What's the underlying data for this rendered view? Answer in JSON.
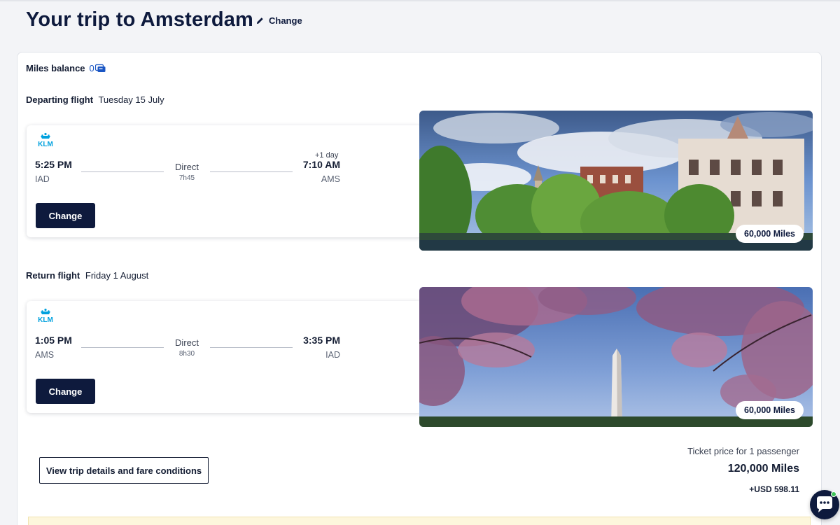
{
  "header": {
    "title": "Your trip to Amsterdam",
    "change_label": "Change"
  },
  "miles_balance": {
    "label": "Miles balance",
    "value": "0"
  },
  "departing": {
    "heading": "Departing flight",
    "date": "Tuesday 15 July",
    "airline": "KLM",
    "depart_time": "5:25 PM",
    "depart_airport": "IAD",
    "stops": "Direct",
    "duration": "7h45",
    "day_offset": "+1 day",
    "arrive_time": "7:10 AM",
    "arrive_airport": "AMS",
    "change_label": "Change",
    "image_icon": "amsterdam-canal-photo",
    "miles": "60,000 Miles"
  },
  "return": {
    "heading": "Return flight",
    "date": "Friday 1 August",
    "airline": "KLM",
    "depart_time": "1:05 PM",
    "depart_airport": "AMS",
    "stops": "Direct",
    "duration": "8h30",
    "arrive_time": "3:35 PM",
    "arrive_airport": "IAD",
    "change_label": "Change",
    "image_icon": "washington-cherry-blossom-photo",
    "miles": "60,000 Miles"
  },
  "footer": {
    "view_details_label": "View trip details and fare conditions",
    "price_label": "Ticket price for 1 passenger",
    "price_miles": "120,000 Miles",
    "price_usd": "+USD 598.11"
  },
  "colors": {
    "navy": "#0e1a3d",
    "klm_blue": "#00a1de",
    "accent_blue": "#1a56c4",
    "page_bg": "#f3f4f7"
  }
}
